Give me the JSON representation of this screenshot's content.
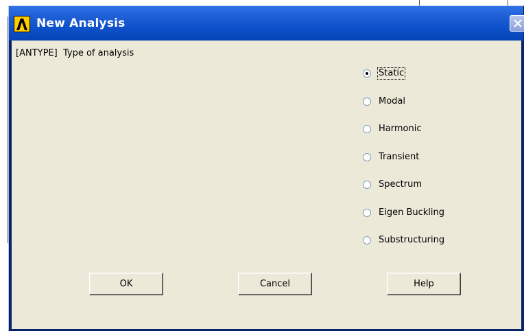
{
  "window": {
    "title": "New Analysis",
    "icon": "ansys-logo-icon",
    "close_icon": "close-icon"
  },
  "prompt": {
    "label": "[ANTYPE]  Type of analysis"
  },
  "analysis_types": {
    "selected": "Static",
    "options": [
      {
        "label": "Static",
        "checked": true
      },
      {
        "label": "Modal",
        "checked": false
      },
      {
        "label": "Harmonic",
        "checked": false
      },
      {
        "label": "Transient",
        "checked": false
      },
      {
        "label": "Spectrum",
        "checked": false
      },
      {
        "label": "Eigen Buckling",
        "checked": false
      },
      {
        "label": "Substructuring",
        "checked": false
      }
    ]
  },
  "buttons": {
    "ok": "OK",
    "cancel": "Cancel",
    "help": "Help"
  },
  "colors": {
    "title_bar": "#0d50c9",
    "dialog_face": "#ece9d8"
  }
}
